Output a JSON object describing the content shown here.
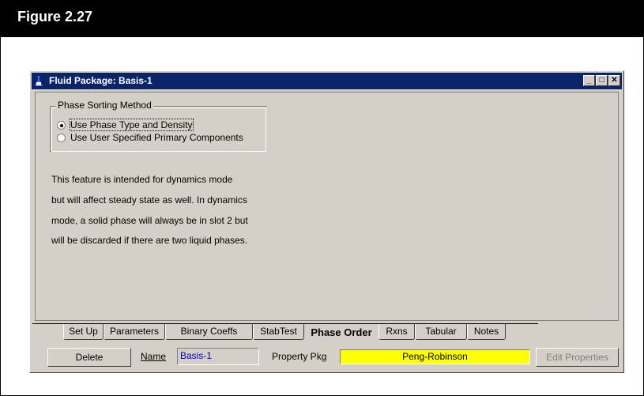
{
  "figure": {
    "label": "Figure 2.27"
  },
  "window": {
    "title": "Fluid Package: Basis-1",
    "min_label": "_",
    "max_label": "□",
    "close_label": "✕"
  },
  "phase_sorting": {
    "group_label": "Phase Sorting Method",
    "options": [
      {
        "label": "Use Phase Type and Density",
        "selected": true
      },
      {
        "label": "Use User Specified Primary Components",
        "selected": false
      }
    ]
  },
  "description": [
    "This feature is intended for dynamics mode",
    "but will affect steady state as well. In dynamics",
    "mode, a solid phase will always be in slot 2 but",
    "will be discarded if there are two liquid phases."
  ],
  "tabs": [
    {
      "label": "Set Up"
    },
    {
      "label": "Parameters"
    },
    {
      "label": "Binary Coeffs"
    },
    {
      "label": "StabTest"
    },
    {
      "label": "Phase Order",
      "active": true
    },
    {
      "label": "Rxns"
    },
    {
      "label": "Tabular"
    },
    {
      "label": "Notes"
    }
  ],
  "bottom": {
    "delete_label": "Delete",
    "name_label": "Name",
    "name_value": "Basis-1",
    "property_pkg_label": "Property Pkg",
    "property_pkg_value": "Peng-Robinson",
    "edit_properties_label": "Edit Properties"
  },
  "colors": {
    "titlebar": "#0a246a",
    "window_bg": "#d4d0c8",
    "property_pkg_bg": "#ffff00",
    "name_text": "#0000c0"
  }
}
